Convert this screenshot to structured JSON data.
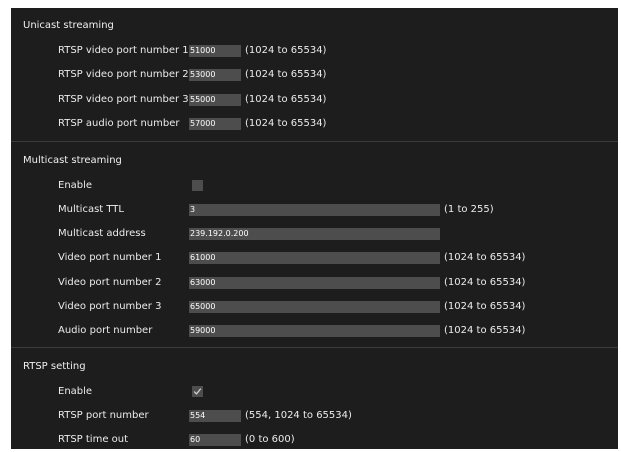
{
  "unicast": {
    "title": "Unicast streaming",
    "rows": [
      {
        "label": "RTSP video port number 1",
        "value": "51000",
        "range": "(1024 to 65534)"
      },
      {
        "label": "RTSP video port number 2",
        "value": "53000",
        "range": "(1024 to 65534)"
      },
      {
        "label": "RTSP video port number 3",
        "value": "55000",
        "range": "(1024 to 65534)"
      },
      {
        "label": "RTSP audio port number",
        "value": "57000",
        "range": "(1024 to 65534)"
      }
    ]
  },
  "multicast": {
    "title": "Multicast streaming",
    "enable_label": "Enable",
    "enable_checked": false,
    "rows": [
      {
        "label": "Multicast TTL",
        "value": "3",
        "range": "(1 to 255)"
      },
      {
        "label": "Multicast address",
        "value": "239.192.0.200",
        "range": ""
      },
      {
        "label": "Video port number 1",
        "value": "61000",
        "range": "(1024 to 65534)"
      },
      {
        "label": "Video port number 2",
        "value": "63000",
        "range": "(1024 to 65534)"
      },
      {
        "label": "Video port number 3",
        "value": "65000",
        "range": "(1024 to 65534)"
      },
      {
        "label": "Audio port number",
        "value": "59000",
        "range": "(1024 to 65534)"
      }
    ]
  },
  "rtsp": {
    "title": "RTSP setting",
    "enable_label": "Enable",
    "enable_checked": true,
    "rows": [
      {
        "label": "RTSP port number",
        "value": "554",
        "range": "(554, 1024 to 65534)"
      },
      {
        "label": "RTSP time out",
        "value": "60",
        "range": "(0 to 600)"
      }
    ]
  },
  "colors": {
    "panel_background": "#1d1d1d",
    "field_background": "#4d4d4d",
    "text": "#ececec"
  },
  "icons": {
    "checkmark": "check-icon"
  }
}
